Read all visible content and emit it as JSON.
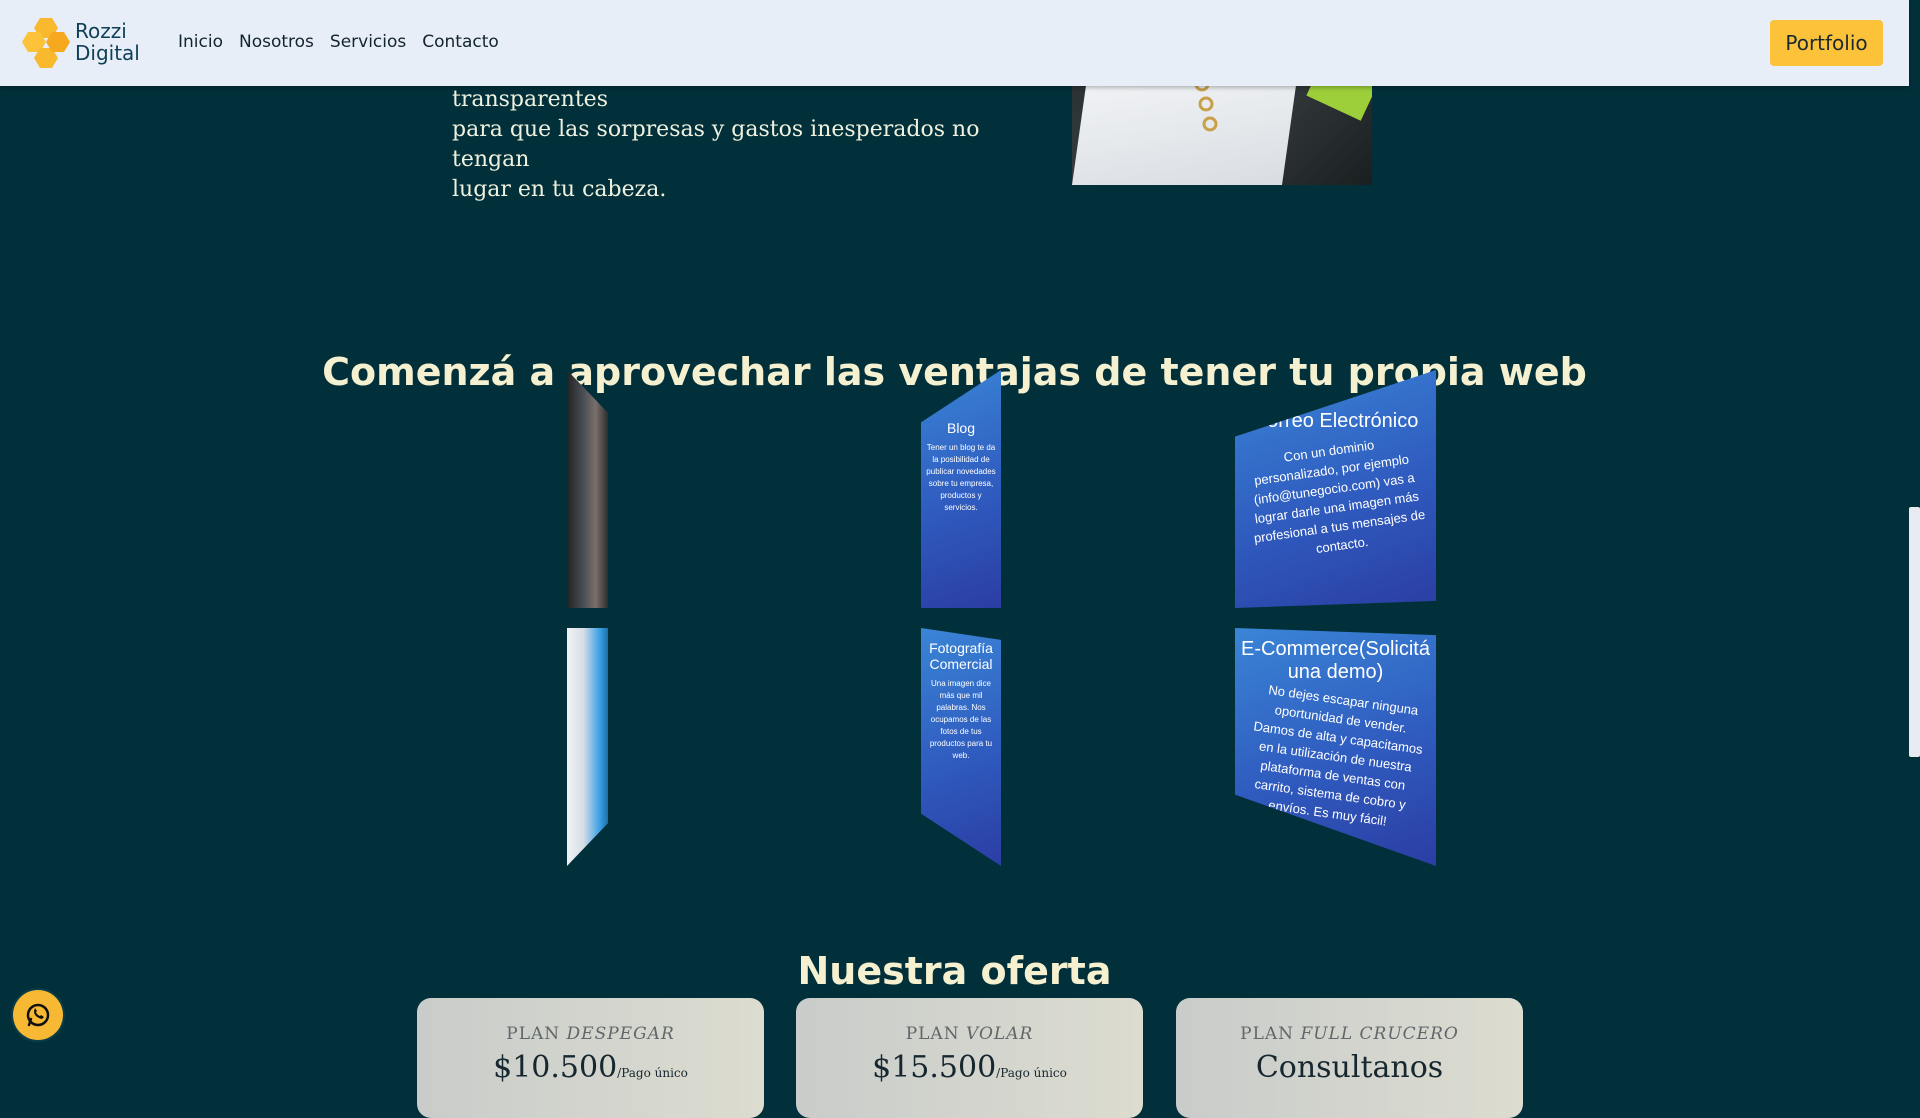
{
  "header": {
    "logo_line1": "Rozzi",
    "logo_line2": "Digital",
    "nav": [
      "Inicio",
      "Nosotros",
      "Servicios",
      "Contacto"
    ],
    "portfolio_label": "Portfolio"
  },
  "intro": {
    "partial_line": "ello que creamos un esquema de precios transparentes",
    "lines": [
      "para que las sorpresas y gastos inesperados no tengan",
      "lugar en tu cabeza."
    ]
  },
  "benefits": {
    "title": "Comenzá a aprovechar las ventajas de tener tu propia web",
    "cards": [
      {
        "title": "",
        "text": ""
      },
      {
        "title": "Blog",
        "text": "Tener un blog te da la posibilidad de publicar novedades sobre tu empresa, productos y servicios."
      },
      {
        "title": "Correo Electrónico",
        "text": "Con un dominio personalizado, por ejemplo (info@tunegocio.com) vas a lograr darle una imagen más profesional a tus mensajes de contacto."
      },
      {
        "title": "",
        "text": ""
      },
      {
        "title": "Fotografía Comercial",
        "text": "Una imagen dice más que mil palabras. Nos ocupamos de las fotos de tus productos para tu web."
      },
      {
        "title": "E-Commerce(Solicitá una demo)",
        "text": "No dejes escapar ninguna oportunidad de vender. Damos de alta y capacitamos en la utilización de nuestra plataforma de ventas con carrito, sistema de cobro y envíos. Es muy fácil!"
      }
    ]
  },
  "offer": {
    "title": "Nuestra oferta",
    "plans": [
      {
        "prefix": "PLAN",
        "name": "DESPEGAR",
        "price": "$10.500",
        "note": "/Pago único"
      },
      {
        "prefix": "PLAN",
        "name": "VOLAR",
        "price": "$15.500",
        "note": "/Pago único"
      },
      {
        "prefix": "PLAN",
        "name": "FULL CRUCERO",
        "price": "Consultanos",
        "note": ""
      }
    ]
  },
  "colors": {
    "background": "#02303a",
    "navbar": "#e7eef8",
    "accent": "#fcc33a",
    "heading": "#f5f0cf"
  },
  "icons": {
    "whatsapp": "whatsapp-icon",
    "logo": "honeycomb-logo-icon"
  }
}
